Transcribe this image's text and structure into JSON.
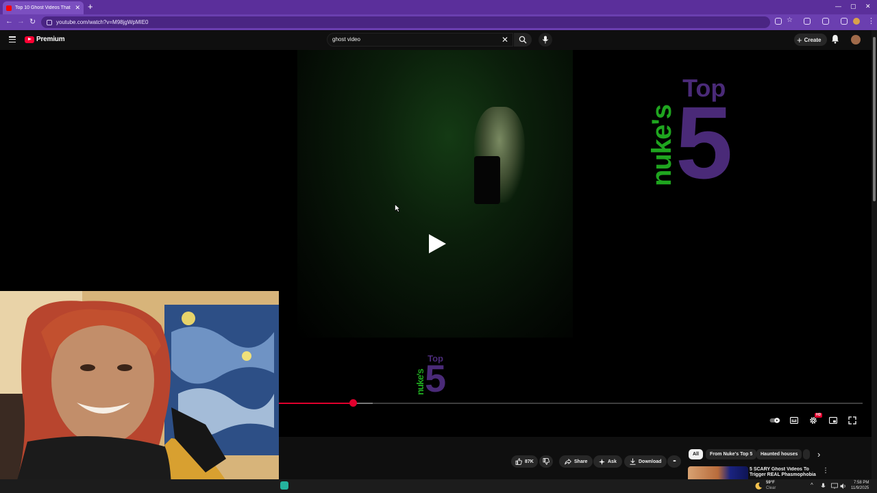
{
  "browser": {
    "tab_title": "Top 10 Ghost Videos That",
    "tab_close": "✕",
    "new_tab": "+",
    "url": "youtube.com/watch?v=M98jgWpMIE0",
    "window_controls": [
      "—",
      "▢",
      "✕"
    ]
  },
  "youtube": {
    "logo_text": "Premium",
    "search_value": "ghost video",
    "search_clear": "✕",
    "create_label": "Create",
    "create_plus": "+"
  },
  "video": {
    "brand_name": "nuke's",
    "brand_top": "Top",
    "brand_number": "5",
    "progress_played": 0.128,
    "progress_buffered": 0.162,
    "hd_badge": "HD"
  },
  "actions": {
    "like_count": "87K",
    "share": "Share",
    "ask": "Ask",
    "download": "Download",
    "more": "•••"
  },
  "chips": {
    "items": [
      "All",
      "From Nuke's Top 5",
      "Haunted houses"
    ],
    "next": "›"
  },
  "recommendation": {
    "title": "5 SCARY Ghost Videos To Trigger REAL Phasmophobia",
    "more": "⋮"
  },
  "taskbar": {
    "temp": "59°F",
    "weather": "Clear",
    "time": "7:58 PM",
    "date": "11/9/2025",
    "tray_arrow": "^"
  },
  "colors": {
    "browser_frame": "#5b2f9b",
    "youtube_red": "#ff0033",
    "progress_red": "#e1002d",
    "brand_green": "#1fa51f",
    "brand_purple": "#4a2a78"
  }
}
